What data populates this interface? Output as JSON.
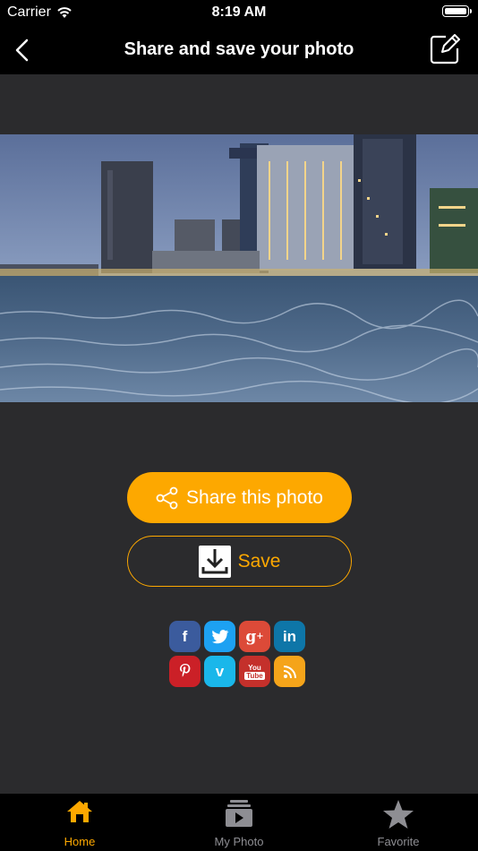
{
  "status": {
    "carrier": "Carrier",
    "time": "8:19 AM"
  },
  "nav": {
    "title": "Share and save your photo"
  },
  "actions": {
    "share_label": "Share this photo",
    "save_label": "Save"
  },
  "social": [
    {
      "name": "facebook",
      "glyph": "f",
      "color": "#3b5b9d"
    },
    {
      "name": "twitter",
      "glyph": "t",
      "color": "#1da1f2"
    },
    {
      "name": "google-plus",
      "glyph": "g+",
      "color": "#dc4a38"
    },
    {
      "name": "linkedin",
      "glyph": "in",
      "color": "#0e76a8"
    },
    {
      "name": "pinterest",
      "glyph": "p",
      "color": "#cb2027"
    },
    {
      "name": "vimeo",
      "glyph": "v",
      "color": "#1ab7ea"
    },
    {
      "name": "youtube",
      "glyph": "You Tube",
      "color": "#c4302b"
    },
    {
      "name": "rss",
      "glyph": "rss",
      "color": "#f5a41a"
    }
  ],
  "tabs": [
    {
      "label": "Home",
      "active": true
    },
    {
      "label": "My Photo",
      "active": false
    },
    {
      "label": "Favorite",
      "active": false
    }
  ],
  "colors": {
    "accent": "#fda800",
    "background": "#2b2b2d",
    "bar": "#000000",
    "inactive": "#8e8e93"
  }
}
